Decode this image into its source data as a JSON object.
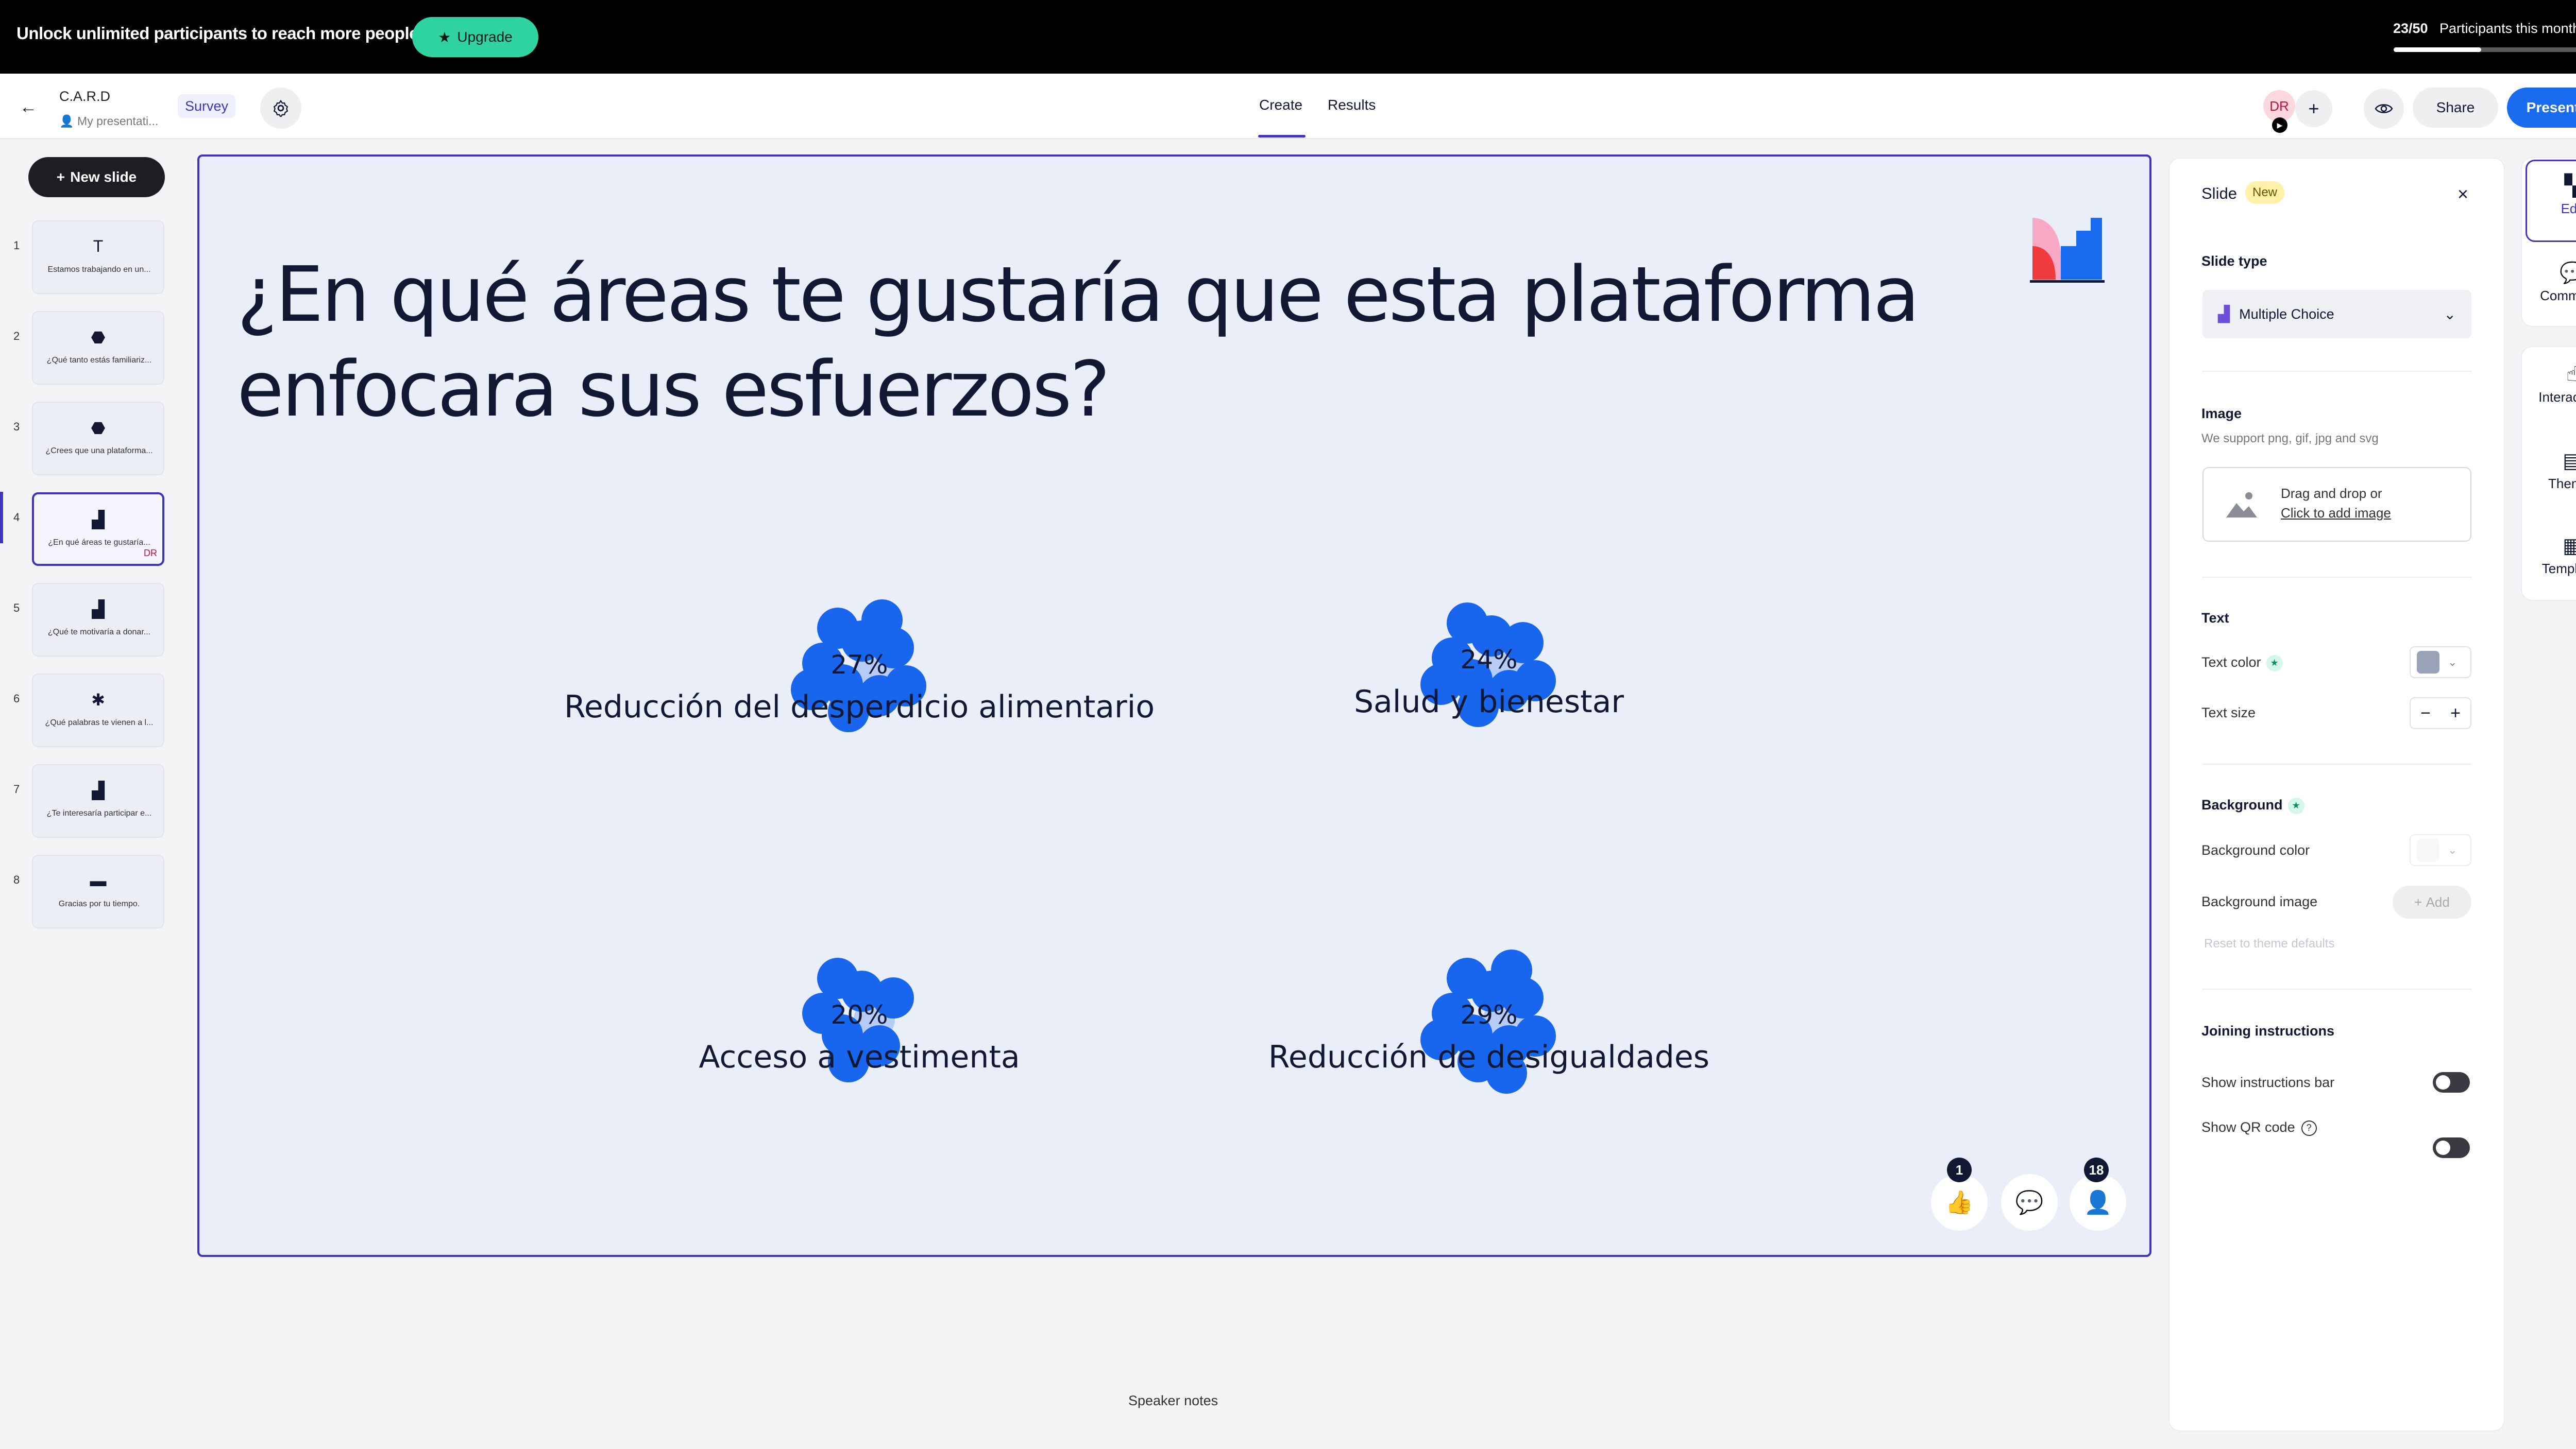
{
  "banner": {
    "message": "Unlock unlimited participants to reach more people.",
    "upgrade_label": "Upgrade",
    "participants_count": "23/50",
    "participants_label": "Participants this month",
    "participants_fraction": 0.46
  },
  "header": {
    "title": "C.A.R.D",
    "subtitle": "My presentati...",
    "type_badge": "Survey",
    "tabs": [
      {
        "label": "Create"
      },
      {
        "label": "Results"
      }
    ],
    "avatar_initials": "DR",
    "share_label": "Share",
    "present_label": "Present"
  },
  "sidebar": {
    "new_slide_label": "New slide",
    "slides": [
      {
        "num": "1",
        "icon": "text-icon",
        "glyph": "T",
        "text": "Estamos trabajando en un..."
      },
      {
        "num": "2",
        "icon": "scale-icon",
        "glyph": "⬣",
        "text": "¿Qué tanto estás familiariz..."
      },
      {
        "num": "3",
        "icon": "scale-icon",
        "glyph": "⬣",
        "text": "¿Crees que una plataforma..."
      },
      {
        "num": "4",
        "icon": "bar-chart-icon",
        "glyph": "▟",
        "text": "¿En qué áreas te gustaría...",
        "badge": "DR"
      },
      {
        "num": "5",
        "icon": "bar-chart-icon",
        "glyph": "▟",
        "text": "¿Qué te motivaría a donar..."
      },
      {
        "num": "6",
        "icon": "wordcloud-icon",
        "glyph": "✱",
        "text": "¿Qué palabras te vienen a l..."
      },
      {
        "num": "7",
        "icon": "bar-chart-icon",
        "glyph": "▟",
        "text": "¿Te interesaría participar e..."
      },
      {
        "num": "8",
        "icon": "screen-icon",
        "glyph": "▬",
        "text": "Gracias por tu tiempo."
      }
    ]
  },
  "slide": {
    "question": "¿En qué áreas te gustaría que esta plataforma enfocara sus esfuerzos?",
    "options": [
      {
        "label": "Reducción del desperdicio alimentario",
        "percent": "27%",
        "value": 27
      },
      {
        "label": "Salud y bienestar",
        "percent": "24%",
        "value": 24
      },
      {
        "label": "Acceso a vestimenta",
        "percent": "20%",
        "value": 20
      },
      {
        "label": "Reducción de desigualdades",
        "percent": "29%",
        "value": 29
      }
    ],
    "reactions": {
      "likes": "1",
      "participants": "18"
    },
    "speaker_notes": "Speaker notes",
    "dot_color": "#1866ee"
  },
  "panel": {
    "title": "Slide",
    "new_badge": "New",
    "slide_type_label": "Slide type",
    "slide_type_value": "Multiple Choice",
    "image_label": "Image",
    "image_hint": "We support png, gif, jpg and svg",
    "drop_text": "Drag and drop or",
    "drop_link": "Click to add image",
    "text_label": "Text",
    "text_color_label": "Text color",
    "text_color": "#9aa3b8",
    "text_size_label": "Text size",
    "background_label": "Background",
    "bg_color_label": "Background color",
    "bg_color": "#f3f4f8",
    "bg_image_label": "Background image",
    "bg_add_label": "Add",
    "reset_label": "Reset to theme defaults",
    "joining_label": "Joining instructions",
    "show_bar_label": "Show instructions bar",
    "show_qr_label": "Show QR code"
  },
  "toolbar": {
    "edit": "Edit",
    "comments": "Comments",
    "interactivity": "Interactivity",
    "themes": "Themes",
    "templates": "Templates"
  },
  "colors": {
    "accent": "#3f33c2",
    "primary": "#196cf0",
    "upgrade": "#2ed3a0"
  }
}
